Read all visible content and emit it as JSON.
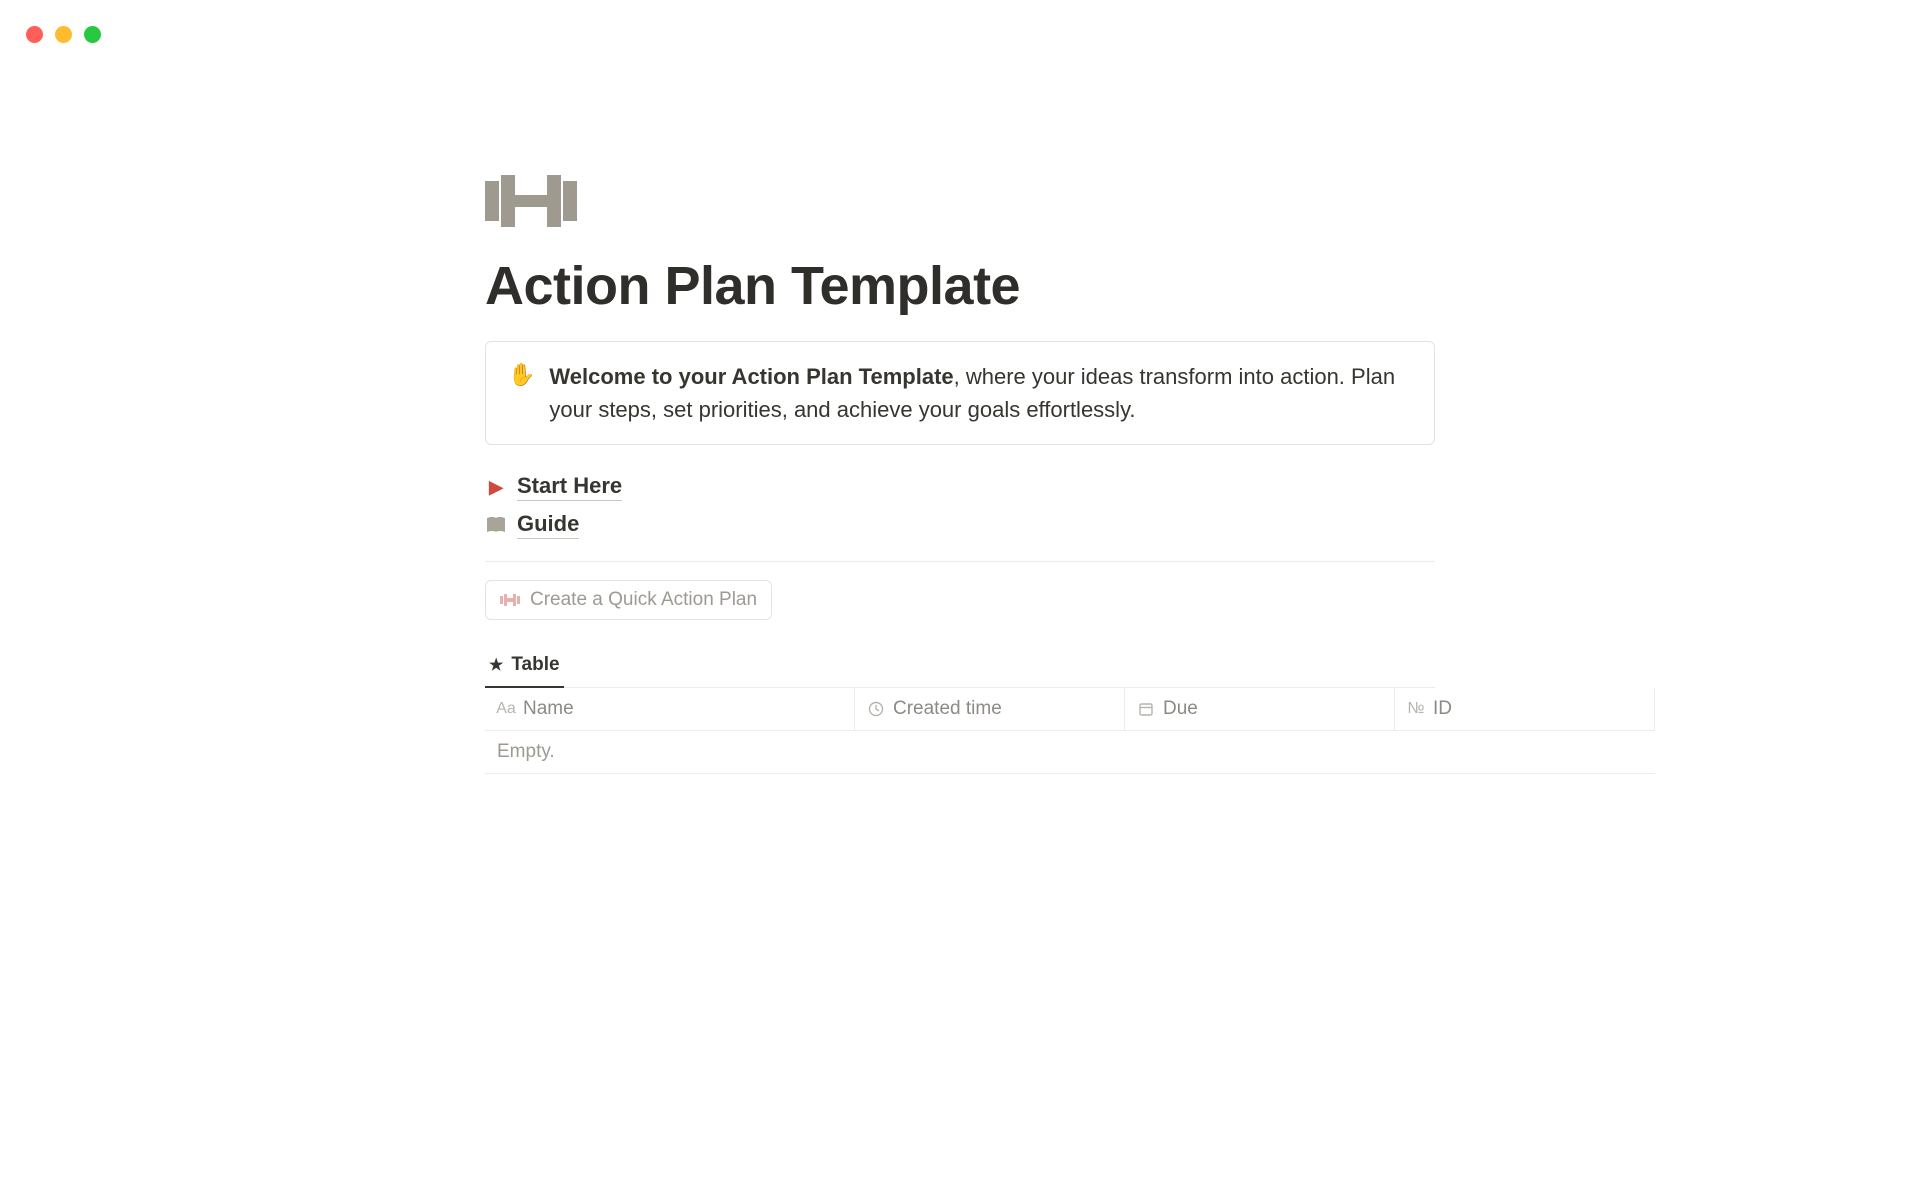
{
  "page": {
    "title": "Action Plan Template"
  },
  "callout": {
    "bold": "Welcome to your Action Plan Template",
    "rest": ", where your ideas transform into action. Plan your steps, set priorities, and achieve your goals effortlessly."
  },
  "links": {
    "start_here": "Start Here",
    "guide": "Guide"
  },
  "quick_button": {
    "label": "Create a Quick Action Plan"
  },
  "tabs": {
    "table": "Table"
  },
  "table": {
    "columns": {
      "name": "Name",
      "created_time": "Created time",
      "due": "Due",
      "id": "ID"
    },
    "empty_text": "Empty."
  }
}
